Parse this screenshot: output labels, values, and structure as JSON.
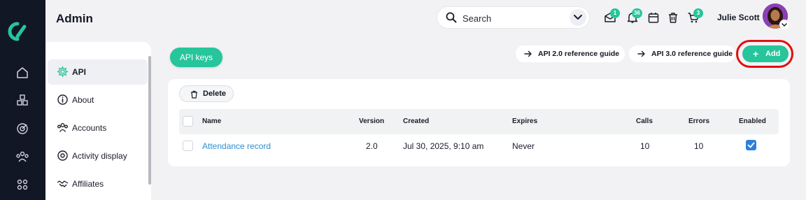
{
  "header": {
    "title": "Admin",
    "search_placeholder": "Search",
    "badges": {
      "inbox": "1",
      "notifications": "36",
      "cart": "3"
    },
    "user_name": "Julie Scott"
  },
  "sidebar": {
    "items": [
      {
        "label": "API",
        "icon": "gear-icon",
        "active": true
      },
      {
        "label": "About",
        "icon": "info-icon",
        "active": false
      },
      {
        "label": "Accounts",
        "icon": "users-icon",
        "active": false
      },
      {
        "label": "Activity display",
        "icon": "target-icon",
        "active": false
      },
      {
        "label": "Affiliates",
        "icon": "handshake-icon",
        "active": false
      }
    ]
  },
  "main": {
    "tab_label": "API keys",
    "ref_guides": [
      "API 2.0 reference guide",
      "API 3.0 reference guide"
    ],
    "add_label": "Add",
    "delete_label": "Delete",
    "columns": [
      "Name",
      "Version",
      "Created",
      "Expires",
      "Calls",
      "Errors",
      "Enabled"
    ],
    "rows": [
      {
        "name": "Attendance record",
        "version": "2.0",
        "created": "Jul 30, 2025, 9:10 am",
        "expires": "Never",
        "calls": "10",
        "errors": "10",
        "enabled": true
      }
    ]
  },
  "colors": {
    "accent": "#26c59b",
    "rail": "#121726",
    "link": "#2f8fd0",
    "highlight_ring": "#e01010",
    "checkbox_checked": "#2f7fd8"
  }
}
